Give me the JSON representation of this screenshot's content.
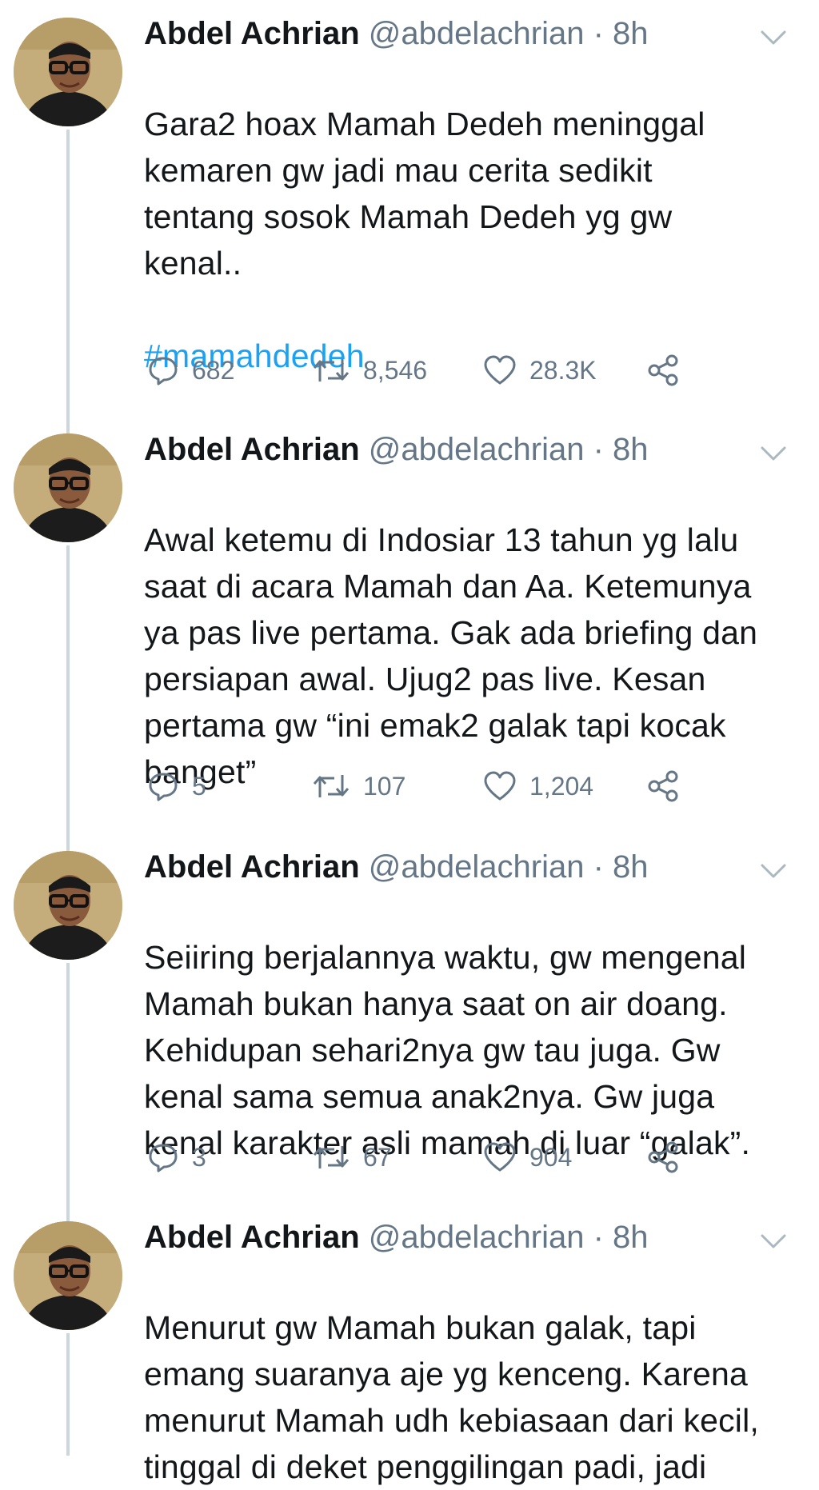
{
  "tweets": [
    {
      "author_name": "Abdel Achrian",
      "author_handle": "@abdelachrian",
      "separator": "·",
      "time": "8h",
      "text": "Gara2 hoax Mamah Dedeh meninggal\nkemaren gw jadi mau cerita sedikit\ntentang sosok Mamah Dedeh yg gw\nkenal..",
      "hashtag": "#mamahdedeh",
      "replies": "682",
      "retweets": "8,546",
      "likes": "28.3K"
    },
    {
      "author_name": "Abdel Achrian",
      "author_handle": "@abdelachrian",
      "separator": "·",
      "time": "8h",
      "text": "Awal ketemu di Indosiar 13 tahun yg lalu\nsaat di acara Mamah dan Aa. Ketemunya\nya pas live pertama. Gak ada briefing dan\npersiapan awal. Ujug2 pas live. Kesan\npertama gw “ini emak2 galak tapi kocak\nbanget”",
      "replies": "5",
      "retweets": "107",
      "likes": "1,204"
    },
    {
      "author_name": "Abdel Achrian",
      "author_handle": "@abdelachrian",
      "separator": "·",
      "time": "8h",
      "text": "Seiiring berjalannya waktu, gw mengenal\nMamah bukan hanya saat on air doang.\nKehidupan sehari2nya gw tau juga. Gw\nkenal sama semua anak2nya. Gw juga\nkenal karakter asli mamah di luar “galak”.",
      "replies": "3",
      "retweets": "67",
      "likes": "904"
    },
    {
      "author_name": "Abdel Achrian",
      "author_handle": "@abdelachrian",
      "separator": "·",
      "time": "8h",
      "text": "Menurut gw Mamah bukan galak, tapi\nemang suaranya aje yg kenceng. Karena\nmenurut Mamah udh kebiasaan dari kecil,\ntinggal di deket penggilingan padi, jadi"
    }
  ],
  "icons": {
    "reply": "reply-icon",
    "retweet": "retweet-icon",
    "like": "heart-icon",
    "share": "share-icon",
    "menu": "chevron-down-icon"
  },
  "colors": {
    "text": "#14171a",
    "secondary": "#657786",
    "link": "#1da1f2",
    "thread_line": "#ccd6dd"
  }
}
